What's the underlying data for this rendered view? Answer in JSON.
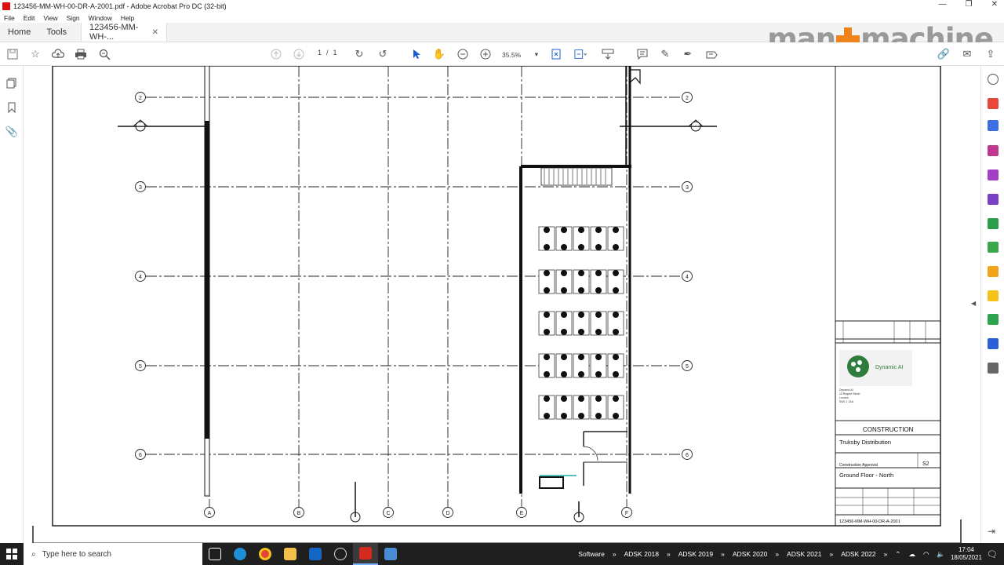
{
  "window": {
    "title": "123456-MM-WH-00-DR-A-2001.pdf - Adobe Acrobat Pro DC (32-bit)"
  },
  "menu": [
    "File",
    "Edit",
    "View",
    "Sign",
    "Window",
    "Help"
  ],
  "tabs": {
    "home": "Home",
    "tools": "Tools",
    "document": "123456-MM-WH-..."
  },
  "brand": {
    "left": "man",
    "right": "machine",
    "accent": "#f0841c"
  },
  "toolbar": {
    "page_current": "1",
    "page_sep": "/",
    "page_total": "1",
    "zoom": "35.5%"
  },
  "drawing": {
    "grid_rows": [
      "2",
      "3",
      "4",
      "5",
      "6"
    ],
    "grid_cols": [
      "A",
      "B",
      "C",
      "D",
      "E",
      "F"
    ]
  },
  "title_block": {
    "company_logo_text": "Dynamic AI",
    "company_address": [
      "Dynamic AI",
      "10 Regent Street",
      "London",
      "SW1 1 1AA"
    ],
    "status": "CONSTRUCTION",
    "project": "Truksby Distribution",
    "purpose": "Construction Approval",
    "revision": "S2",
    "drawing_title": "Ground Floor - North",
    "drawing_number": "123456-MM-WH-00-DR-A-2001"
  },
  "taskbar": {
    "search_placeholder": "Type here to search",
    "toolbars": [
      "Software",
      "ADSK 2018",
      "ADSK 2019",
      "ADSK 2020",
      "ADSK 2021",
      "ADSK 2022"
    ],
    "time": "17:04",
    "date": "18/05/2021"
  }
}
